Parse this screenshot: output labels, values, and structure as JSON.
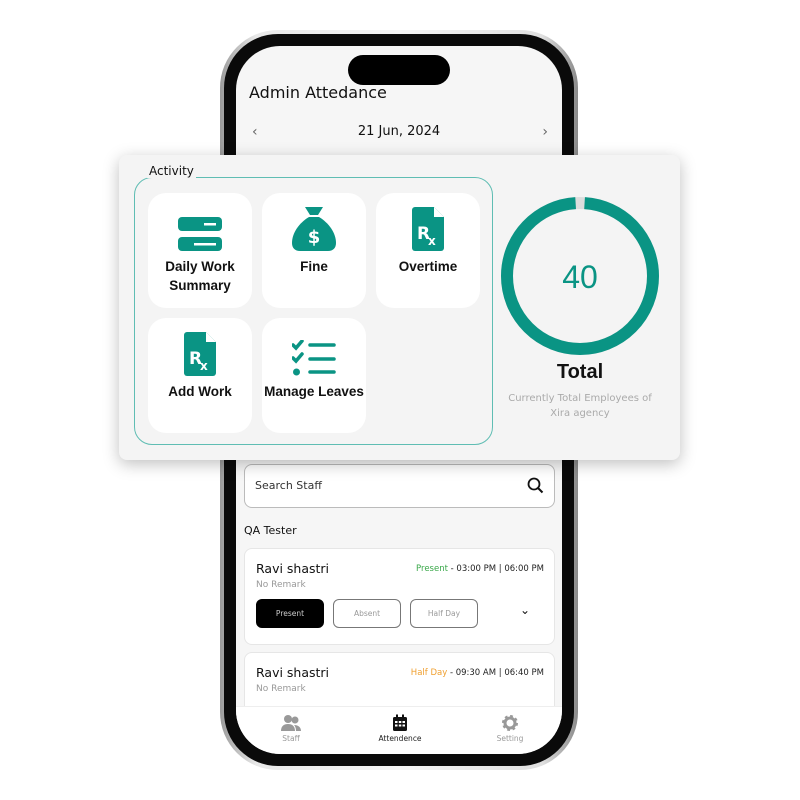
{
  "colors": {
    "accent": "#0A9484",
    "present": "#3aa84a",
    "halfday": "#f0a030"
  },
  "header": {
    "title": "Admin Attedance",
    "date": "21 Jun, 2024"
  },
  "search": {
    "placeholder": "Search Staff"
  },
  "section": "QA Tester",
  "staff": [
    {
      "name": "Ravi shastri",
      "remark": "No Remark",
      "status": "Present",
      "times": " - 03:00 PM | 06:00 PM",
      "buttons": [
        "Present",
        "Absent",
        "Half Day"
      ],
      "selected": "Present"
    },
    {
      "name": "Ravi shastri",
      "remark": "No Remark",
      "status": "Half Day",
      "times": " - 09:30 AM | 06:40 PM"
    }
  ],
  "nav": [
    {
      "label": "Staff",
      "icon": "users-icon"
    },
    {
      "label": "Attendence",
      "icon": "calendar-icon",
      "active": true
    },
    {
      "label": "Setting",
      "icon": "gear-icon"
    }
  ],
  "activity": {
    "label": "Activity",
    "tiles": [
      {
        "label": "Daily Work Summary",
        "icon": "server-icon"
      },
      {
        "label": "Fine",
        "icon": "money-bag-icon"
      },
      {
        "label": "Overtime",
        "icon": "prescription-file-icon"
      },
      {
        "label": "Add Work",
        "icon": "prescription-file-icon"
      },
      {
        "label": "Manage Leaves",
        "icon": "checklist-icon"
      }
    ]
  },
  "total": {
    "value": "40",
    "label": "Total",
    "subtitle": "Currently Total Employees of Xira agency",
    "ring_fill_percent": 98
  }
}
